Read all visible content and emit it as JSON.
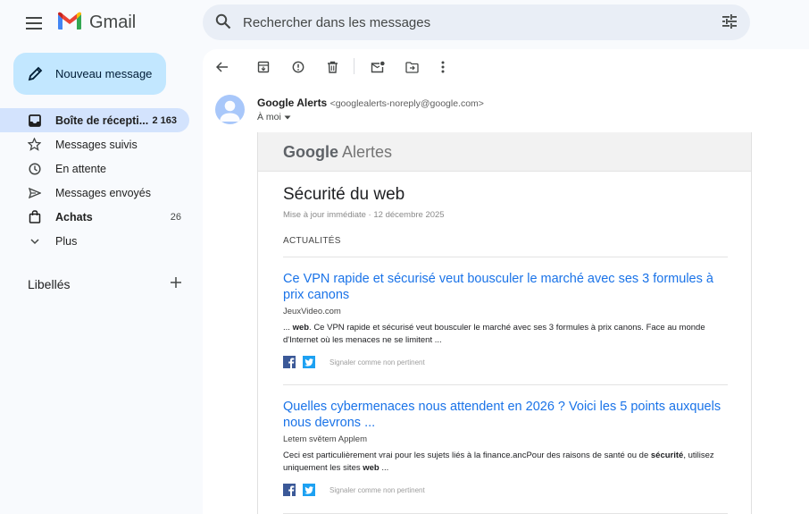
{
  "app": {
    "name": "Gmail",
    "brand_colors": {
      "red": "#ea4335",
      "blue": "#4285f4",
      "green": "#34a853",
      "yellow": "#fbbc04"
    }
  },
  "header": {
    "menu_icon": "hamburger-icon",
    "search_placeholder": "Rechercher dans les messages",
    "search_icon": "search-icon",
    "filter_icon": "tune-icon"
  },
  "sidebar": {
    "compose_label": "Nouveau message",
    "items": [
      {
        "label": "Boîte de récepti...",
        "count": "2 163",
        "icon": "inbox-icon",
        "active": true
      },
      {
        "label": "Messages suivis",
        "count": "",
        "icon": "star-icon"
      },
      {
        "label": "En attente",
        "count": "",
        "icon": "clock-icon"
      },
      {
        "label": "Messages envoyés",
        "count": "",
        "icon": "send-icon"
      },
      {
        "label": "Achats",
        "count": "26",
        "icon": "shopping-icon",
        "bold": true
      },
      {
        "label": "Plus",
        "count": "",
        "icon": "chevron-down-icon"
      }
    ],
    "labels_title": "Libellés"
  },
  "toolbar": {
    "icons": [
      "back-arrow-icon",
      "archive-icon",
      "report-spam-icon",
      "delete-icon",
      "mark-unread-icon",
      "move-to-icon",
      "more-vert-icon"
    ]
  },
  "message": {
    "sender_name": "Google Alerts",
    "sender_email": "<googlealerts-noreply@google.com>",
    "to": "À moi"
  },
  "email": {
    "logo_google": "Google",
    "logo_alerts": "Alertes",
    "topic": "Sécurité du web",
    "meta": "Mise à jour immédiate  ·  12 décembre 2025",
    "section": "ACTUALITÉS",
    "flag_label": "Signaler comme non pertinent",
    "articles": [
      {
        "title": "Ce VPN rapide et sécurisé veut bousculer le marché avec ses 3 formules à prix canons",
        "source": "JeuxVideo.com",
        "snippet_pre": "... ",
        "snippet_bold": "web",
        "snippet_post": ". Ce VPN rapide et sécurisé veut bousculer le marché avec ses 3 formules à prix canons. Face au monde d'Internet où les menaces ne se limitent ..."
      },
      {
        "title": "Quelles cybermenaces nous attendent en 2026 ? Voici les 5 points auxquels nous devrons ...",
        "source": "Letem světem Applem",
        "snippet_pre": "Ceci est particulièrement vrai pour les sujets liés à la finance.ancPour des raisons de santé ou de ",
        "snippet_bold": "sécurité",
        "snippet_mid": ", utilisez uniquement les sites ",
        "snippet_bold2": "web",
        "snippet_post": " ..."
      }
    ]
  }
}
